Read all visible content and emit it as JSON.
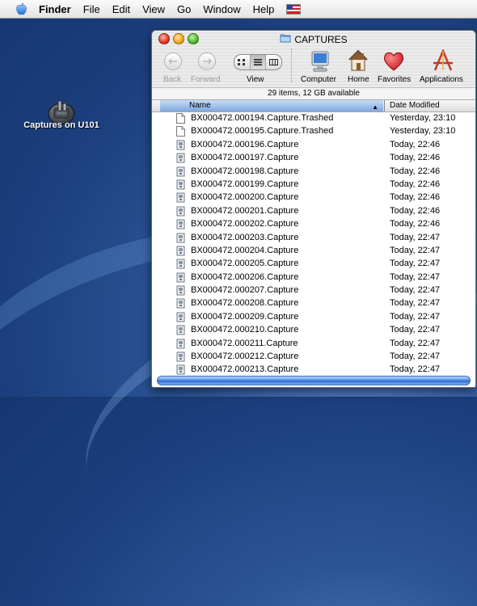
{
  "menubar": {
    "items": [
      "Finder",
      "File",
      "Edit",
      "View",
      "Go",
      "Window",
      "Help"
    ]
  },
  "desktop": {
    "disk_label": "Captures on U101"
  },
  "window": {
    "title": "CAPTURES",
    "toolbar": {
      "back": "Back",
      "forward": "Forward",
      "view": "View",
      "computer": "Computer",
      "home": "Home",
      "favorites": "Favorites",
      "applications": "Applications"
    },
    "status": "29 items, 12 GB available",
    "columns": {
      "name": "Name",
      "date": "Date Modified"
    },
    "files": [
      {
        "name": "BX000472.000194.Capture.Trashed",
        "date": "Yesterday, 23:10",
        "type": "doc"
      },
      {
        "name": "BX000472.000195.Capture.Trashed",
        "date": "Yesterday, 23:10",
        "type": "doc"
      },
      {
        "name": "BX000472.000196.Capture",
        "date": "Today, 22:46",
        "type": "capture"
      },
      {
        "name": "BX000472.000197.Capture",
        "date": "Today, 22:46",
        "type": "capture"
      },
      {
        "name": "BX000472.000198.Capture",
        "date": "Today, 22:46",
        "type": "capture"
      },
      {
        "name": "BX000472.000199.Capture",
        "date": "Today, 22:46",
        "type": "capture"
      },
      {
        "name": "BX000472.000200.Capture",
        "date": "Today, 22:46",
        "type": "capture"
      },
      {
        "name": "BX000472.000201.Capture",
        "date": "Today, 22:46",
        "type": "capture"
      },
      {
        "name": "BX000472.000202.Capture",
        "date": "Today, 22:46",
        "type": "capture"
      },
      {
        "name": "BX000472.000203.Capture",
        "date": "Today, 22:47",
        "type": "capture"
      },
      {
        "name": "BX000472.000204.Capture",
        "date": "Today, 22:47",
        "type": "capture"
      },
      {
        "name": "BX000472.000205.Capture",
        "date": "Today, 22:47",
        "type": "capture"
      },
      {
        "name": "BX000472.000206.Capture",
        "date": "Today, 22:47",
        "type": "capture"
      },
      {
        "name": "BX000472.000207.Capture",
        "date": "Today, 22:47",
        "type": "capture"
      },
      {
        "name": "BX000472.000208.Capture",
        "date": "Today, 22:47",
        "type": "capture"
      },
      {
        "name": "BX000472.000209.Capture",
        "date": "Today, 22:47",
        "type": "capture"
      },
      {
        "name": "BX000472.000210.Capture",
        "date": "Today, 22:47",
        "type": "capture"
      },
      {
        "name": "BX000472.000211.Capture",
        "date": "Today, 22:47",
        "type": "capture"
      },
      {
        "name": "BX000472.000212.Capture",
        "date": "Today, 22:47",
        "type": "capture"
      },
      {
        "name": "BX000472.000213.Capture",
        "date": "Today, 22:47",
        "type": "capture"
      }
    ]
  },
  "colors": {
    "desktop": "#1f4686",
    "header_selected": "#7ea7e0",
    "scrollbar": "#2a6ad0"
  }
}
